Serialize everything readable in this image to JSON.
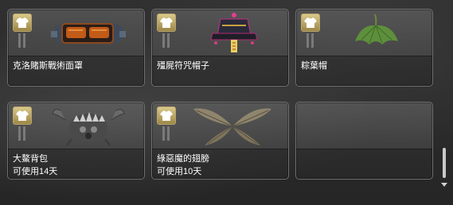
{
  "inventory": {
    "items": [
      {
        "name": "克洛賭斯戰術面罩",
        "sub": "",
        "art": "tactical-mask-icon",
        "empty": false
      },
      {
        "name": "殭屍符咒帽子",
        "sub": "",
        "art": "zombie-talisman-hat-icon",
        "empty": false
      },
      {
        "name": "粽葉帽",
        "sub": "",
        "art": "leaf-hat-icon",
        "empty": false
      },
      {
        "name": "大鰲背包",
        "sub": "可使用14天",
        "art": "crab-backpack-icon",
        "empty": false
      },
      {
        "name": "綠惡魔的翅膀",
        "sub": "可使用10天",
        "art": "green-devil-wings-icon",
        "empty": false
      },
      {
        "name": "",
        "sub": "",
        "art": "",
        "empty": true
      }
    ],
    "badge_icon": "shirt-icon",
    "colors": {
      "badge": "#c8b574",
      "card_border": "#6f6f6f",
      "text": "#ffffff"
    }
  }
}
